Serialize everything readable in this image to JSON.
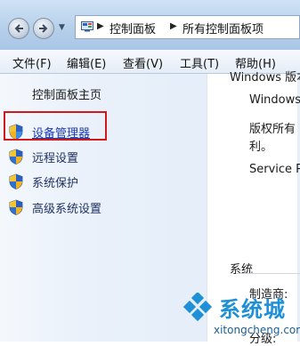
{
  "address_bar": {
    "breadcrumbs": [
      "控制面板",
      "所有控制面板项"
    ]
  },
  "menu": {
    "items": [
      "文件(F)",
      "编辑(E)",
      "查看(V)",
      "工具(T)",
      "帮助(H)"
    ]
  },
  "left_pane": {
    "home_link": "控制面板主页",
    "tasks": [
      {
        "label": "设备管理器",
        "icon": "shield-icon",
        "highlighted": true
      },
      {
        "label": "远程设置",
        "icon": "shield-icon"
      },
      {
        "label": "系统保护",
        "icon": "shield-icon"
      },
      {
        "label": "高级系统设置",
        "icon": "shield-icon"
      }
    ]
  },
  "right_pane": {
    "edition_header": "Windows 版本",
    "edition_name": "Windows",
    "copyright_line1": "版权所有",
    "copyright_line2": "利。",
    "service_pack": "Service P",
    "system_header": "系统",
    "manufacturer_label": "制造商:",
    "model_label": "分级:"
  },
  "watermark": {
    "brand": "系统城",
    "url": "xitongcheng.com"
  },
  "colors": {
    "highlight_box": "#d0191b",
    "link": "#1a3ab0",
    "logo_blue": "#1f8fd6"
  }
}
